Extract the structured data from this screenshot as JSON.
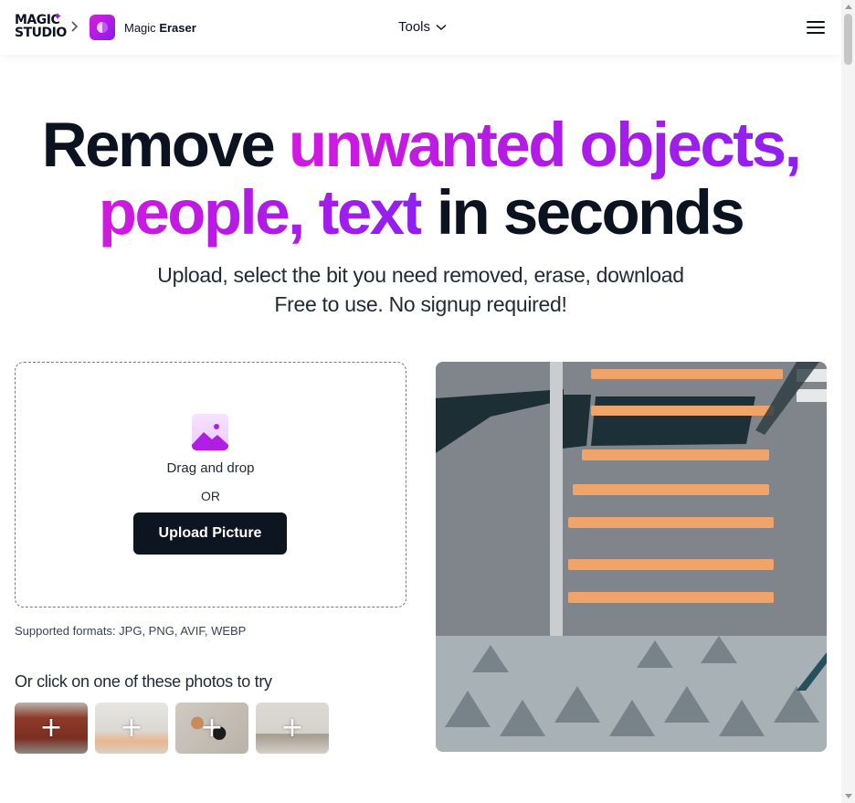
{
  "header": {
    "brand_line1": "MAGIC",
    "brand_line2": "STUDIO",
    "app_name_prefix": "Magic",
    "app_name_bold": "Eraser",
    "tools_label": "Tools"
  },
  "hero": {
    "title_plain_1": "Remove ",
    "title_grad_1": "unwanted objects,",
    "title_grad_2": "people, text",
    "title_plain_2": " in seconds",
    "subtitle_line1": "Upload, select the bit you need removed, erase, download",
    "subtitle_line2": "Free to use. No signup required!"
  },
  "upload": {
    "drag_text": "Drag and drop",
    "or_text": "OR",
    "button_label": "Upload Picture",
    "formats": "Supported formats: JPG, PNG, AVIF, WEBP"
  },
  "samples": {
    "title": "Or click on one of these photos to try",
    "plus": "+"
  },
  "colors": {
    "accent_start": "#d319e0",
    "accent_end": "#8f20f0",
    "button_bg": "#0d1521",
    "text_dark": "#0b1220"
  }
}
